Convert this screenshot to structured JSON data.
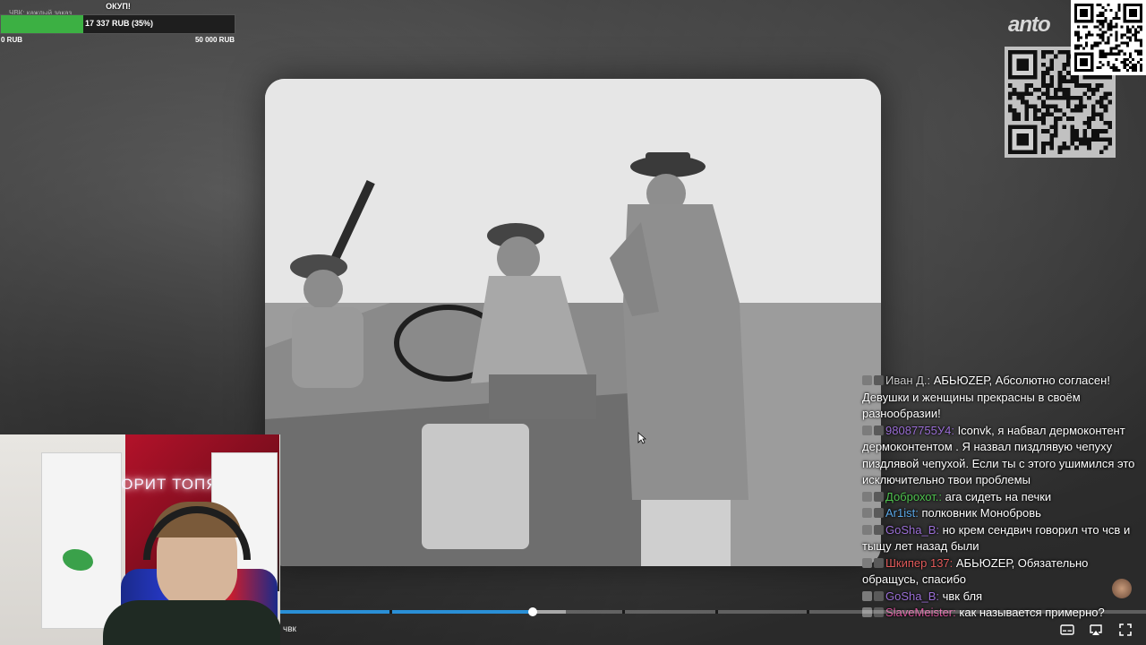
{
  "donation": {
    "title": "ОКУП!",
    "subtitle": "ЧВК: каждый заказ ...",
    "amount_text": "17 337 RUB (35%)",
    "progress": 0.35,
    "min_label": "0 RUB",
    "max_label": "50 000 RUB",
    "fill_color": "#3cb043"
  },
  "brand": "anto",
  "webcam": {
    "neon_sign": "ГОВОРИТ ТОПЯZ"
  },
  "chat": {
    "messages": [
      {
        "nick": "Иван Д.",
        "nick_color": "#c9c9c9",
        "text": "АБЬЮZЕР, Абсолютно согласен! Девушки и женщины прекрасны в своём разнообразии!"
      },
      {
        "nick": "98087755У4",
        "nick_color": "#9b6fd6",
        "text": "Iconvk, я набвал дермоконтент дермоконтентом . Я назвал пиздлявую чепуху пиздлявой чепухой. Если ты с этого ушимился это исключительно твои проблемы"
      },
      {
        "nick": "Доброхот.",
        "nick_color": "#4fc24f",
        "text": "ага сидеть на печки"
      },
      {
        "nick": "Ar1ist",
        "nick_color": "#5aa7e6",
        "text": "полковник Монобровь"
      },
      {
        "nick": "GoSha_B",
        "nick_color": "#9b6fd6",
        "text": "но крем сендвич говорил что чсв и тыщу лет назад были"
      },
      {
        "nick": "Шкипер 137",
        "nick_color": "#e05a5a",
        "text": "АБЬЮZЕР, Обязательно обращусь, спасибо"
      },
      {
        "nick": "GoSha_B",
        "nick_color": "#9b6fd6",
        "text": "чвк бля"
      },
      {
        "nick": "SlaveMeister",
        "nick_color": "#d8529a",
        "text": "как называется примерно?"
      }
    ]
  },
  "player": {
    "title": "чвк",
    "played_fraction": 0.292,
    "buffered_fraction": 0.33,
    "play_color": "#2a8fd6",
    "icons": [
      "subtitles-icon",
      "airplay-icon",
      "fullscreen-icon"
    ]
  }
}
